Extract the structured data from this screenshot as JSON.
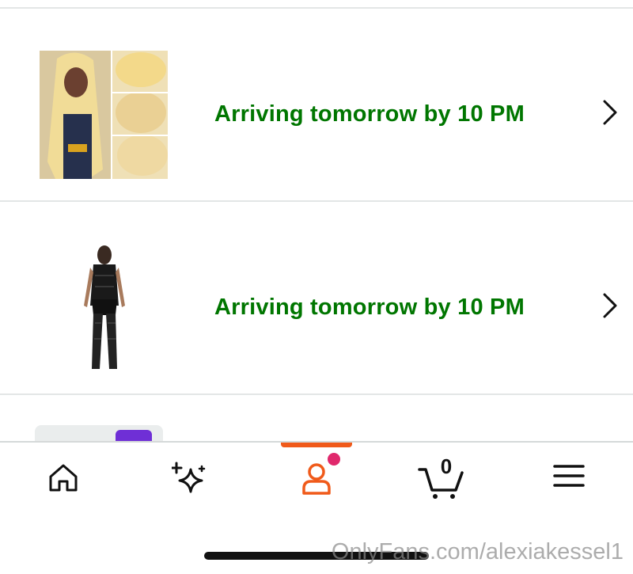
{
  "orders": [
    {
      "status": "Arriving tomorrow by 10 PM",
      "thumbnail": "blonde-lace-wig-product"
    },
    {
      "status": "Arriving tomorrow by 10 PM",
      "thumbnail": "black-lace-bodystocking-product"
    }
  ],
  "bottom_nav": {
    "items": [
      "home-icon",
      "sparkle-icon",
      "account-icon",
      "cart-icon",
      "menu-icon"
    ],
    "active": "account-icon",
    "cart_count": "0"
  },
  "watermark": "OnlyFans.com/alexiakessel1",
  "colors": {
    "status_green": "#007600",
    "active_orange": "#f05a1a",
    "notification_pink": "#e0286c"
  }
}
